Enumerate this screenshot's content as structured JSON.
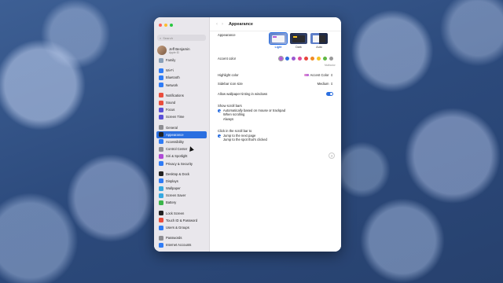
{
  "sidebar": {
    "search_placeholder": "Search",
    "account": {
      "name": "Jeff Benjamin",
      "sub": "Apple ID"
    },
    "groups": [
      [
        {
          "label": "Family",
          "icon": "family-icon",
          "color": "#8aa0b8"
        }
      ],
      [
        {
          "label": "Wi-Fi",
          "icon": "wifi-icon",
          "color": "#2f7cf6"
        },
        {
          "label": "Bluetooth",
          "icon": "bluetooth-icon",
          "color": "#2f7cf6"
        },
        {
          "label": "Network",
          "icon": "network-icon",
          "color": "#2f7cf6"
        }
      ],
      [
        {
          "label": "Notifications",
          "icon": "bell-icon",
          "color": "#ea4d3d"
        },
        {
          "label": "Sound",
          "icon": "speaker-icon",
          "color": "#ea4d3d"
        },
        {
          "label": "Focus",
          "icon": "moon-icon",
          "color": "#5b50d6"
        },
        {
          "label": "Screen Time",
          "icon": "hourglass-icon",
          "color": "#5b50d6"
        }
      ],
      [
        {
          "label": "General",
          "icon": "gear-icon",
          "color": "#8e8e93"
        },
        {
          "label": "Appearance",
          "icon": "appearance-icon",
          "color": "#222222",
          "selected": true
        },
        {
          "label": "Accessibility",
          "icon": "accessibility-icon",
          "color": "#2f7cf6"
        },
        {
          "label": "Control Center",
          "icon": "control-center-icon",
          "color": "#8e8e93"
        },
        {
          "label": "Siri & Spotlight",
          "icon": "siri-icon",
          "color": "#b04ad6"
        },
        {
          "label": "Privacy & Security",
          "icon": "hand-icon",
          "color": "#2f7cf6"
        }
      ],
      [
        {
          "label": "Desktop & Dock",
          "icon": "dock-icon",
          "color": "#222222"
        },
        {
          "label": "Displays",
          "icon": "display-icon",
          "color": "#2f7cf6"
        },
        {
          "label": "Wallpaper",
          "icon": "wallpaper-icon",
          "color": "#36a9e1"
        },
        {
          "label": "Screen Saver",
          "icon": "screensaver-icon",
          "color": "#36a9e1"
        },
        {
          "label": "Battery",
          "icon": "battery-icon",
          "color": "#3bb54a"
        }
      ],
      [
        {
          "label": "Lock Screen",
          "icon": "lock-icon",
          "color": "#222222"
        },
        {
          "label": "Touch ID & Password",
          "icon": "fingerprint-icon",
          "color": "#ea4d3d"
        },
        {
          "label": "Users & Groups",
          "icon": "users-icon",
          "color": "#2f7cf6"
        }
      ],
      [
        {
          "label": "Passwords",
          "icon": "key-icon",
          "color": "#8e8e93"
        },
        {
          "label": "Internet Accounts",
          "icon": "at-icon",
          "color": "#2f7cf6"
        }
      ]
    ]
  },
  "main": {
    "title": "Appearance",
    "appearance": {
      "label": "Appearance",
      "options": [
        {
          "label": "Light",
          "selected": true
        },
        {
          "label": "Dark"
        },
        {
          "label": "Auto"
        }
      ]
    },
    "accent": {
      "label": "Accent color",
      "sub": "Multicolor",
      "colors": [
        "#b25cd9",
        "#2b6fe0",
        "#9b59d0",
        "#e04c9a",
        "#e8453c",
        "#f08a24",
        "#f5c324",
        "#5fb844",
        "#9a9a9a"
      ]
    },
    "highlight": {
      "label": "Highlight color",
      "value": "Accent Color"
    },
    "sidebar_icon": {
      "label": "Sidebar icon size",
      "value": "Medium"
    },
    "tinting": {
      "label": "Allow wallpaper tinting in windows"
    },
    "scroll_bars": {
      "label": "Show scroll bars",
      "options": [
        "Automatically based on mouse or trackpad",
        "When scrolling",
        "Always"
      ]
    },
    "click_bar": {
      "label": "Click in the scroll bar to",
      "options": [
        "Jump to the next page",
        "Jump to the spot that's clicked"
      ]
    },
    "help": "?"
  }
}
